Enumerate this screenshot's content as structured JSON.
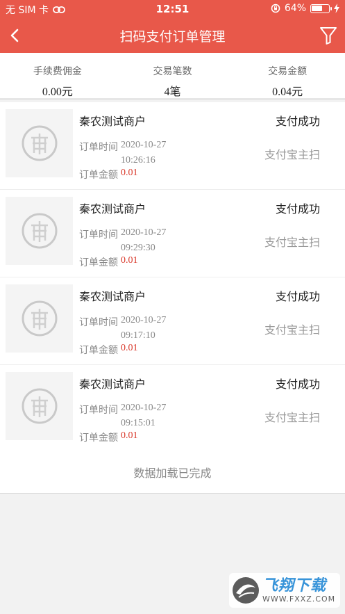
{
  "status_bar": {
    "carrier": "无 SIM 卡",
    "time": "12:51",
    "battery_pct": "64%",
    "battery_level": 0.64
  },
  "nav": {
    "title": "扫码支付订单管理",
    "back_icon": "chevron-left-icon",
    "filter_icon": "funnel-icon"
  },
  "summary": [
    {
      "label": "手续费佣金",
      "value": "0.00元"
    },
    {
      "label": "交易笔数",
      "value": "4笔"
    },
    {
      "label": "交易金额",
      "value": "0.04元"
    }
  ],
  "orders": [
    {
      "merchant": "秦农测试商户",
      "status": "支付成功",
      "time_label": "订单时间",
      "date": "2020-10-27",
      "clock": "10:26:16",
      "amount_label": "订单金额",
      "amount": "0.01",
      "pay_type": "支付宝主扫"
    },
    {
      "merchant": "秦农测试商户",
      "status": "支付成功",
      "time_label": "订单时间",
      "date": "2020-10-27",
      "clock": "09:29:30",
      "amount_label": "订单金额",
      "amount": "0.01",
      "pay_type": "支付宝主扫"
    },
    {
      "merchant": "秦农测试商户",
      "status": "支付成功",
      "time_label": "订单时间",
      "date": "2020-10-27",
      "clock": "09:17:10",
      "amount_label": "订单金额",
      "amount": "0.01",
      "pay_type": "支付宝主扫"
    },
    {
      "merchant": "秦农测试商户",
      "status": "支付成功",
      "time_label": "订单时间",
      "date": "2020-10-27",
      "clock": "09:15:01",
      "amount_label": "订单金额",
      "amount": "0.01",
      "pay_type": "支付宝主扫"
    }
  ],
  "load_status": "数据加载已完成",
  "watermark": {
    "title": "飞翔下载",
    "url": "WWW.FXXZ.COM"
  },
  "colors": {
    "accent": "#e8584a",
    "amount": "#d9382a"
  }
}
